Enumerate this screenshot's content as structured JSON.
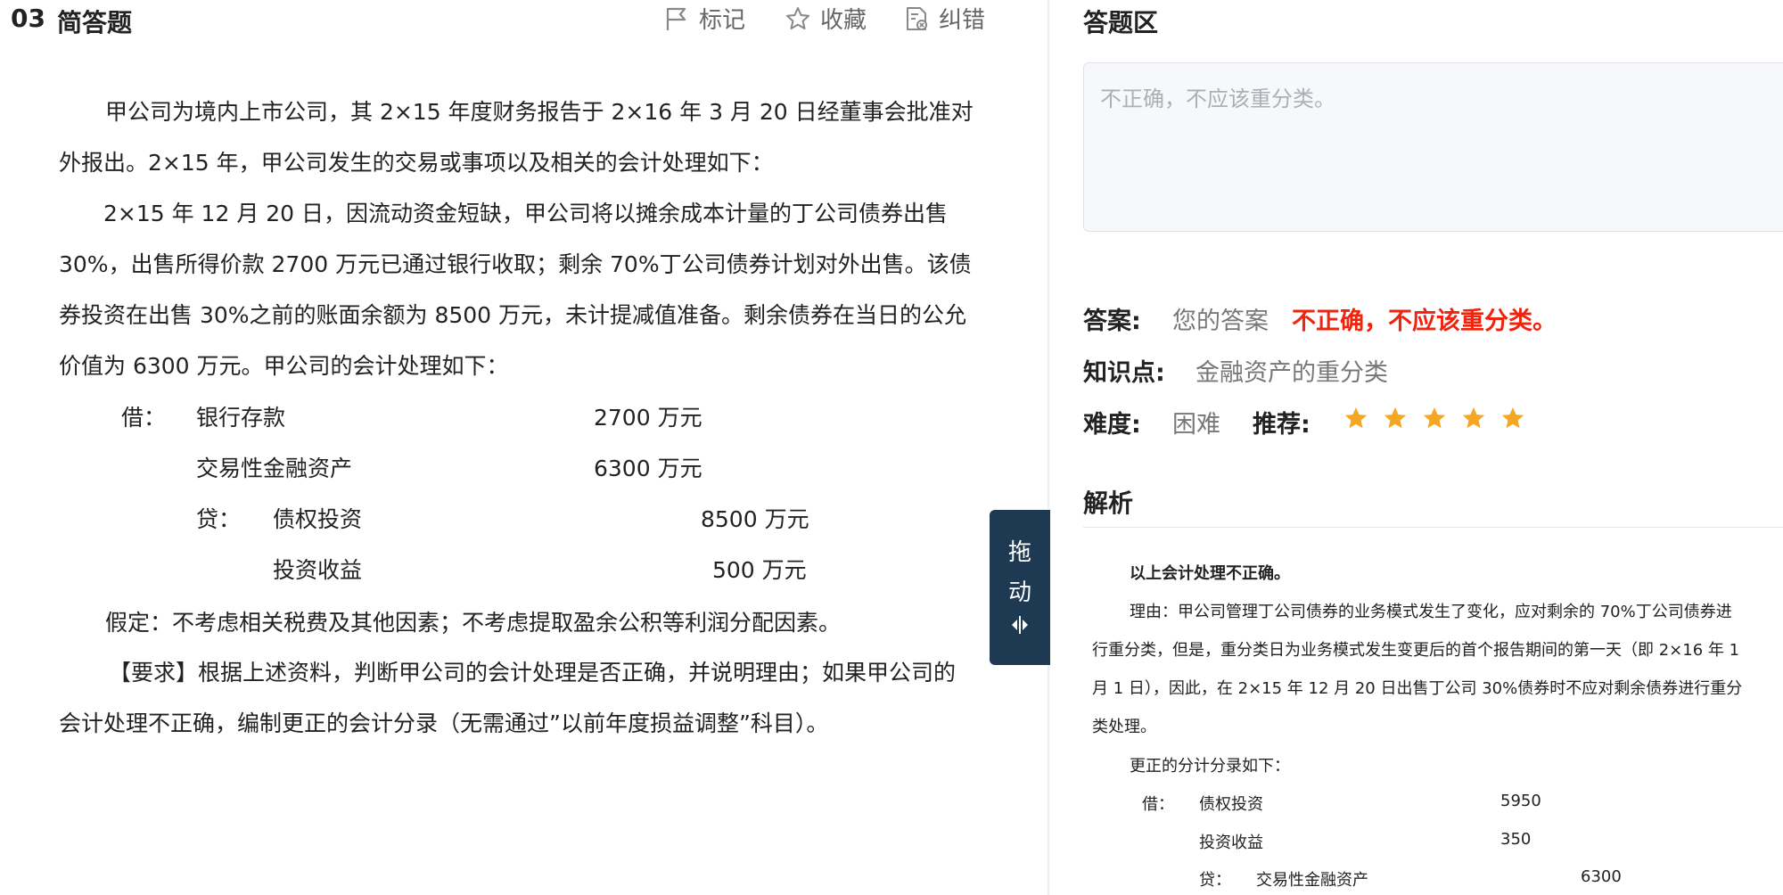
{
  "question": {
    "number": "03",
    "type": "简答题",
    "tools": {
      "mark": "标记",
      "favorite": "收藏",
      "report": "纠错"
    },
    "lines": [
      "甲公司为境内上市公司，其 2×15 年度财务报告于 2×16 年 3 月 20 日经董事会批准对",
      "外报出。2×15 年，甲公司发生的交易或事项以及相关的会计处理如下：",
      "2×15 年 12 月 20 日，因流动资金短缺，甲公司将以摊余成本计量的丁公司债券出售",
      "30%，出售所得价款 2700 万元已通过银行收取；剩余 70%丁公司债券计划对外出售。该债",
      "券投资在出售 30%之前的账面余额为 8500 万元，未计提减值准备。剩余债券在当日的公允",
      "价值为 6300 万元。甲公司的会计处理如下："
    ],
    "entry": {
      "debit_mark": "借：",
      "debit1_account": "银行存款",
      "debit1_amount": "2700 万元",
      "debit2_account": "交易性金融资产",
      "debit2_amount": "6300 万元",
      "credit_mark": "贷：",
      "credit1_account": "债权投资",
      "credit1_amount": "8500 万元",
      "credit2_account": "投资收益",
      "credit2_amount": "500 万元"
    },
    "assumption": "假定：不考虑相关税费及其他因素；不考虑提取盈余公积等利润分配因素。",
    "requirement_1": "【要求】根据上述资料，判断甲公司的会计处理是否正确，并说明理由；如果甲公司的",
    "requirement_2": "会计处理不正确，编制更正的会计分录（无需通过”以前年度损益调整”科目）。"
  },
  "drag_handle": {
    "char1": "拖",
    "char2": "动",
    "icon": "drag-arrows-icon"
  },
  "answer_area": {
    "title": "答题区",
    "user_text": "不正确，不应该重分类。",
    "answer_label": "答案:",
    "your_answer_label": "您的答案",
    "your_answer_value": "不正确，不应该重分类。",
    "knowledge_label": "知识点:",
    "knowledge_value": "金融资产的重分类",
    "difficulty_label": "难度:",
    "difficulty_value": "困难",
    "recommend_label": "推荐:",
    "recommend_stars": 5,
    "analysis_title": "解析"
  },
  "analysis": {
    "heading": "以上会计处理不正确。",
    "lines": [
      "理由：甲公司管理丁公司债券的业务模式发生了变化，应对剩余的 70%丁公司债券进",
      "行重分类，但是，重分类日为业务模式发生变更后的首个报告期间的第一天（即 2×16 年 1",
      "月 1 日），因此，在 2×15 年 12 月 20 日出售丁公司 30%债券时不应对剩余债券进行重分",
      "类处理。"
    ],
    "correction_title": "更正的分计分录如下：",
    "entry": {
      "debit_mark": "借：",
      "debit1_account": "债权投资",
      "debit1_amount": "5950",
      "debit2_account": "投资收益",
      "debit2_amount": "350",
      "credit_mark": "贷：",
      "credit1_account": "交易性金融资产",
      "credit1_amount": "6300"
    }
  },
  "colors": {
    "accent_dark": "#1d3a52",
    "wrong_red": "#f0230e",
    "star": "#f5a623"
  }
}
